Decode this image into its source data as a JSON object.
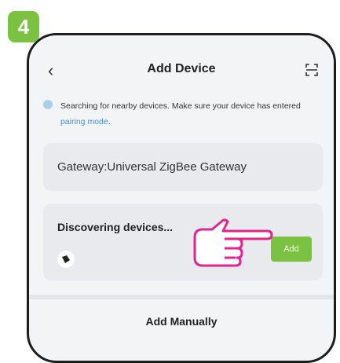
{
  "step": {
    "number": "4",
    "color": "#7cc242"
  },
  "header": {
    "back_icon": "chevron-left-icon",
    "title": "Add Device",
    "scan_icon": "scan-icon"
  },
  "info": {
    "text": "Searching for nearby devices. Make sure your device has entered ",
    "link": "pairing mode",
    "suffix": "."
  },
  "gateway": {
    "label": "Gateway:Universal ZigBee Gateway"
  },
  "discovery": {
    "heading": "Discovering devices...",
    "device_icon": "sensor-icon",
    "add_label": "Add"
  },
  "footer": {
    "manual_label": "Add Manually"
  },
  "colors": {
    "accent": "#7cc242",
    "link": "#3d8fe5",
    "pointer": "#e0268e"
  }
}
